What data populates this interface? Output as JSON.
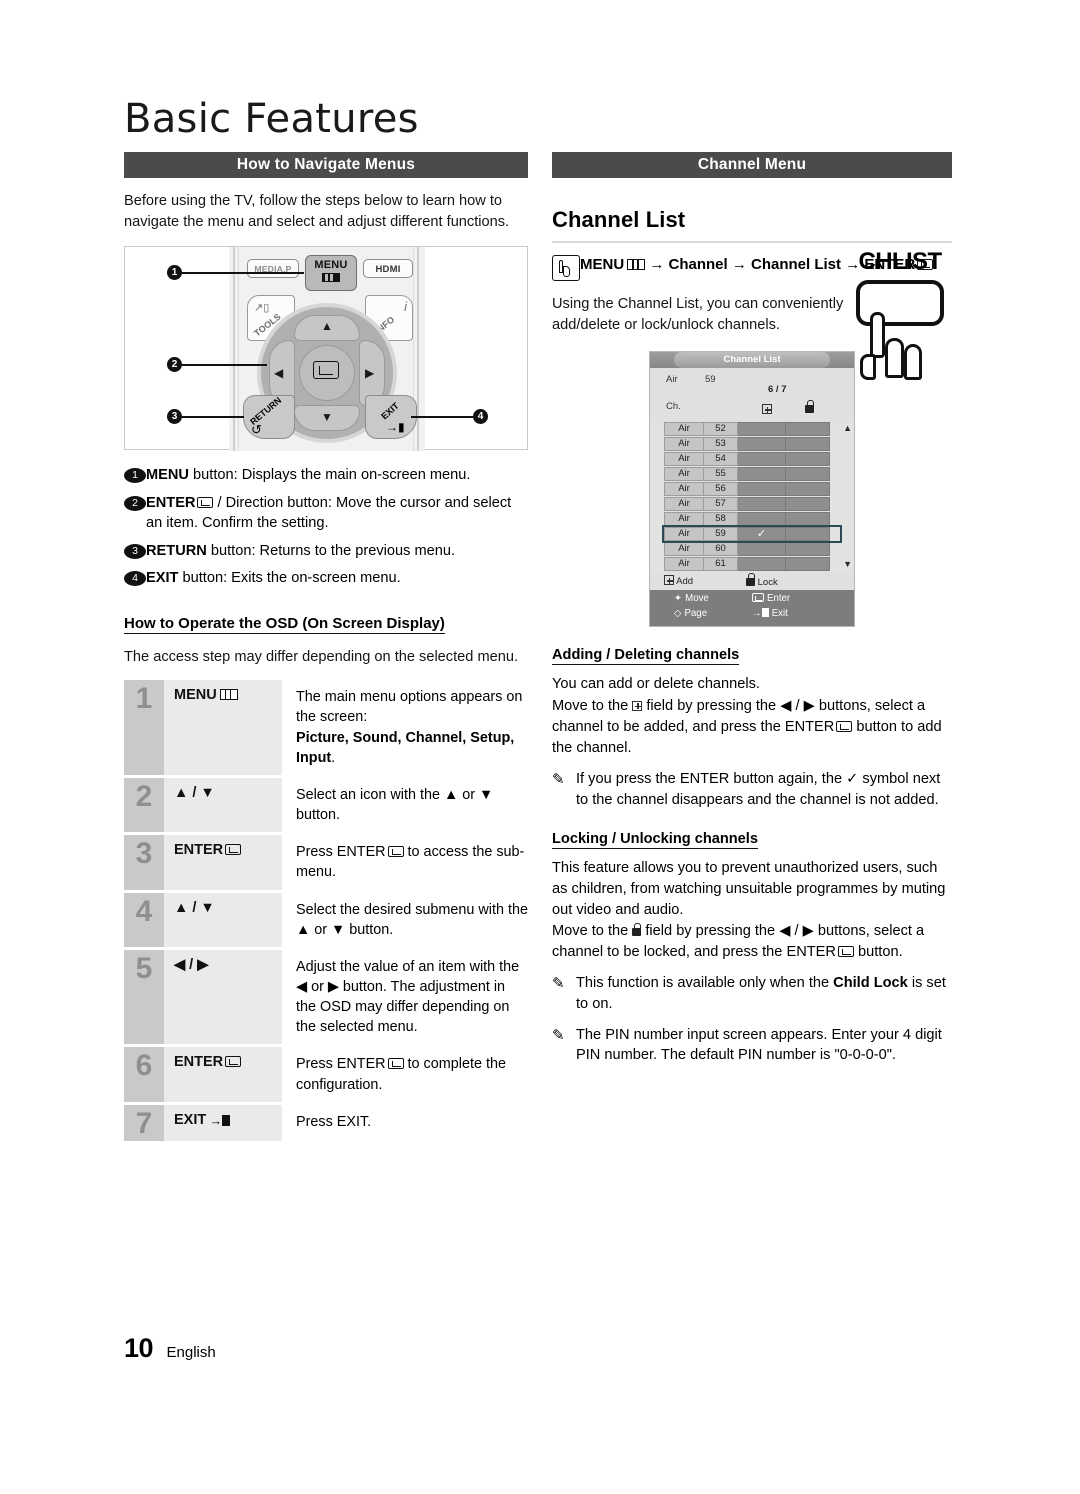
{
  "document": {
    "title": "Basic Features",
    "page_number": "10",
    "language": "English"
  },
  "left_column": {
    "section_bar": "How to Navigate Menus",
    "intro": "Before using the TV, follow the steps below to learn how to navigate the menu and select and adjust different functions.",
    "remote_diagram": {
      "buttons": {
        "media_p": "MEDIA.P",
        "menu": "MENU",
        "hdmi": "HDMI",
        "tools": "TOOLS",
        "info": "INFO",
        "info_sub": "i",
        "return": "RETURN",
        "exit": "EXIT"
      },
      "callouts": [
        "1",
        "2",
        "3",
        "4"
      ],
      "arrows": {
        "up": "▲",
        "down": "▼",
        "left": "◀",
        "right": "▶"
      }
    },
    "bullets": [
      {
        "num": "1",
        "label": "MENU",
        "text": " button: Displays the main on-screen menu."
      },
      {
        "num": "2",
        "label": "ENTER",
        "text": " / Direction button: Move the cursor and select an item. Confirm the setting."
      },
      {
        "num": "3",
        "label": "RETURN",
        "text": " button: Returns to the previous menu."
      },
      {
        "num": "4",
        "label": "EXIT",
        "text": " button: Exits the on-screen menu."
      }
    ],
    "osd_subhead": "How to Operate the OSD (On Screen Display)",
    "osd_intro": "The access step may differ depending on the selected menu.",
    "steps": [
      {
        "num": "1",
        "label": "MENU",
        "desc_1": "The main menu options appears on the screen:",
        "desc_bold": "Picture, Sound, Channel, Setup, Input",
        "desc_2": "."
      },
      {
        "num": "2",
        "label": "▲ / ▼",
        "desc_1": "Select an icon with the ▲ or ▼ button.",
        "desc_bold": "",
        "desc_2": ""
      },
      {
        "num": "3",
        "label": "ENTER",
        "desc_1": "Press ENTER",
        "desc_bold": "",
        "desc_2": " to access the sub-menu."
      },
      {
        "num": "4",
        "label": "▲ / ▼",
        "desc_1": "Select the desired submenu with the ▲ or ▼ button.",
        "desc_bold": "",
        "desc_2": ""
      },
      {
        "num": "5",
        "label": "◀ / ▶",
        "desc_1": "Adjust the value of an item with the ◀ or ▶ button. The adjustment in the OSD may differ depending on the selected menu.",
        "desc_bold": "",
        "desc_2": ""
      },
      {
        "num": "6",
        "label": "ENTER",
        "desc_1": "Press ENTER",
        "desc_bold": "",
        "desc_2": " to complete the configuration."
      },
      {
        "num": "7",
        "label": "EXIT",
        "desc_1": "Press EXIT.",
        "desc_bold": "",
        "desc_2": ""
      }
    ]
  },
  "right_column": {
    "section_bar": "Channel Menu",
    "heading": "Channel List",
    "menu_path": {
      "part_1": "MENU",
      "part_2": " → Channel → Channel List → ENTER",
      "icon": "hand-pointer-icon"
    },
    "description": "Using the Channel List, you can conveniently add/delete or lock/unlock channels.",
    "chlist_button": {
      "label": "CHLIST"
    },
    "osd": {
      "title": "Channel List",
      "current_source": "Air",
      "current_channel": "59",
      "page_indicator": "6 / 7",
      "column_header": "Ch.",
      "column_add_icon": "plus-box-icon",
      "column_lock_icon": "lock-icon",
      "rows": [
        {
          "source": "Air",
          "channel": "52",
          "added": false,
          "locked": false,
          "selected": false
        },
        {
          "source": "Air",
          "channel": "53",
          "added": false,
          "locked": false,
          "selected": false
        },
        {
          "source": "Air",
          "channel": "54",
          "added": false,
          "locked": false,
          "selected": false
        },
        {
          "source": "Air",
          "channel": "55",
          "added": false,
          "locked": false,
          "selected": false
        },
        {
          "source": "Air",
          "channel": "56",
          "added": false,
          "locked": false,
          "selected": false
        },
        {
          "source": "Air",
          "channel": "57",
          "added": false,
          "locked": false,
          "selected": false
        },
        {
          "source": "Air",
          "channel": "58",
          "added": false,
          "locked": false,
          "selected": false
        },
        {
          "source": "Air",
          "channel": "59",
          "added": true,
          "locked": false,
          "selected": true
        },
        {
          "source": "Air",
          "channel": "60",
          "added": false,
          "locked": false,
          "selected": false
        },
        {
          "source": "Air",
          "channel": "61",
          "added": false,
          "locked": false,
          "selected": false
        }
      ],
      "legend": {
        "add": "Add",
        "lock": "Lock"
      },
      "footer": {
        "move": "Move",
        "page": "Page",
        "enter": "Enter",
        "exit": "Exit"
      },
      "scroll_up": "▲",
      "scroll_down": "▼",
      "check_mark": "✓"
    },
    "adding_deleting": {
      "subhead": "Adding / Deleting channels",
      "line_1": "You can add or delete channels.",
      "line_2_a": "Move to the ",
      "line_2_b": " field by pressing the ◀ / ▶ buttons, select a channel to be added, and press the ENTER",
      "line_2_c": " button to add the channel.",
      "note": "If you press the ENTER button again, the ✓ symbol next to the channel disappears and the channel is not added."
    },
    "locking_unlocking": {
      "subhead": "Locking / Unlocking channels",
      "line_1": "This feature allows you to prevent unauthorized users, such as children, from watching unsuitable programmes by muting out video and audio.",
      "line_2_a": "Move to the ",
      "line_2_b": " field by pressing the ◀ / ▶ buttons, select a channel to be locked, and press the ENTER",
      "line_2_c": " button.",
      "note_1_a": "This function is available only when the ",
      "note_1_bold": "Child Lock",
      "note_1_b": " is set to on.",
      "note_2": "The PIN number input screen appears. Enter your 4 digit PIN number. The default PIN number is \"0-0-0-0\"."
    }
  },
  "colors": {
    "section_bar_bg": "#4b4b4b",
    "section_bar_text": "#ffffff",
    "step_num_bg": "#c9c9c9",
    "step_label_bg": "#eaeaea",
    "osd_selected_outline": "#2b4a55",
    "osd_panel_bg": "#e0e0e0",
    "osd_footer_bg": "#7d7d7d"
  }
}
